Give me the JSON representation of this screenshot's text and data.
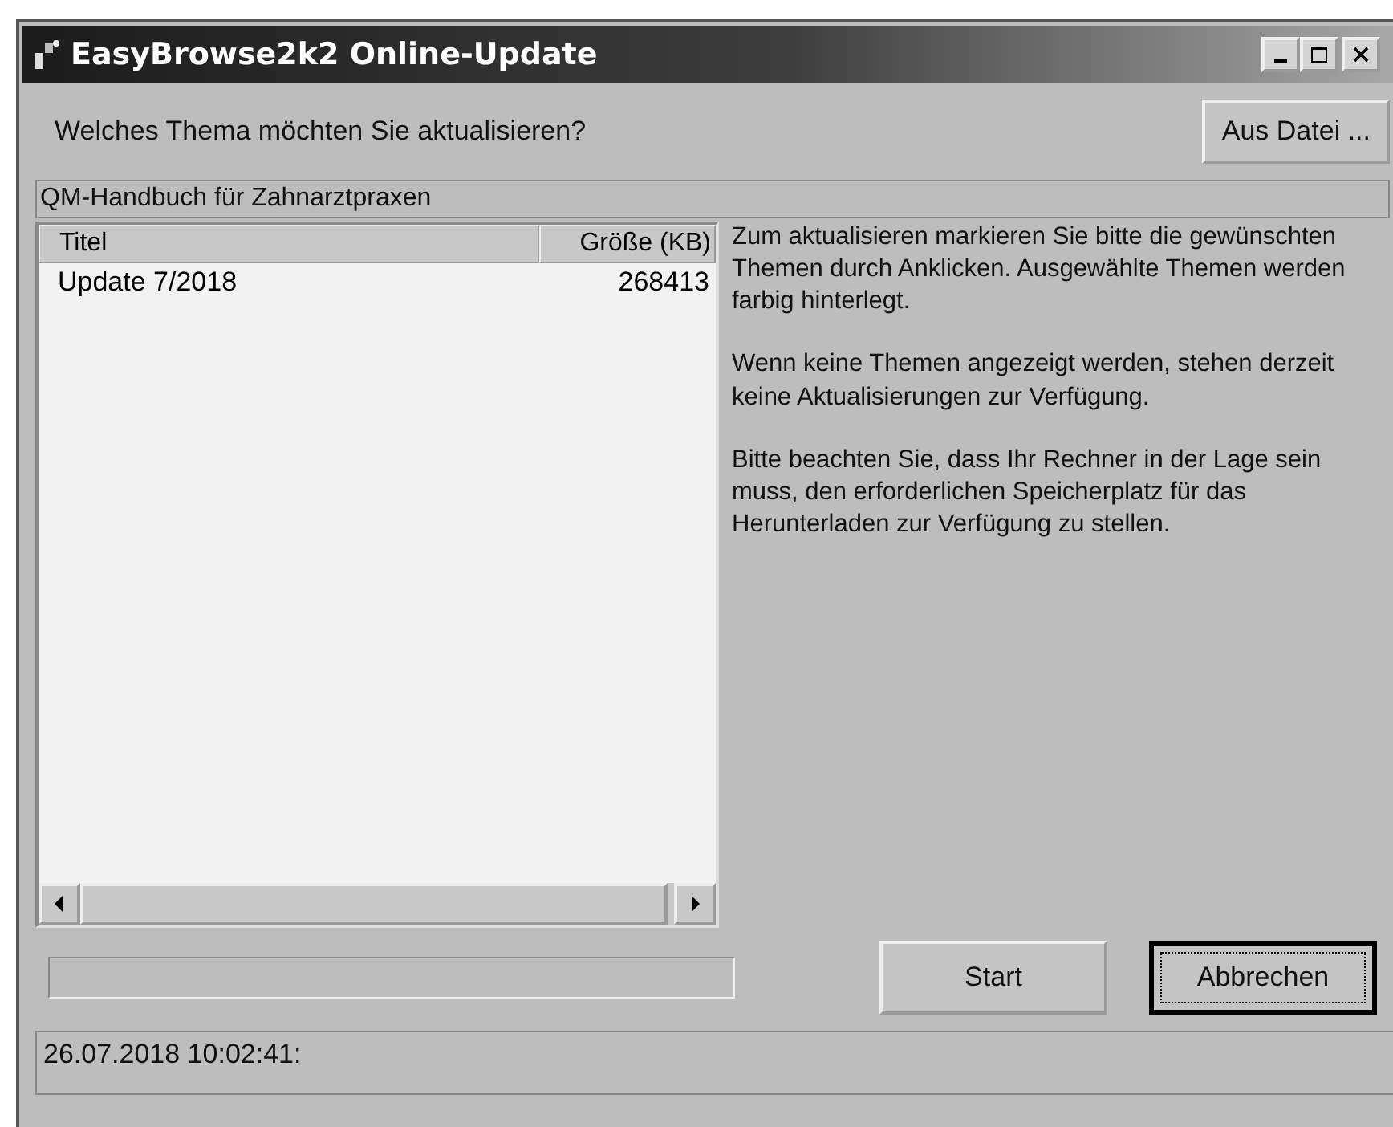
{
  "window": {
    "title": "EasyBrowse2k2 Online-Update"
  },
  "question": "Welches Thema möchten Sie aktualisieren?",
  "buttons_top": [
    {
      "label": "Aus Datei ..."
    }
  ],
  "theme": "QM-Handbuch für Zahnarztpraxen",
  "table": {
    "columns": [
      "Titel",
      "Größe (KB)"
    ],
    "rows": [
      {
        "cells": [
          "Update 7/2018",
          "268413"
        ],
        "selected": false
      }
    ]
  },
  "info": [
    "Zum aktualisieren markieren Sie bitte die gewünschten Themen durch Anklicken. Ausgewählte Themen werden farbig hinterlegt.",
    "Wenn keine Themen angezeigt werden, stehen derzeit keine Aktualisierungen zur Verfügung.",
    "Bitte beachten Sie, dass Ihr Rechner in der Lage sein muss, den erforderlichen Speicherplatz für das Herunterladen zur Verfügung zu stellen."
  ],
  "buttons": [
    {
      "label": "Start",
      "default": false
    },
    {
      "label": "Abbrechen",
      "default": true
    }
  ],
  "status_bar": "26.07.2018 10:02:41:"
}
